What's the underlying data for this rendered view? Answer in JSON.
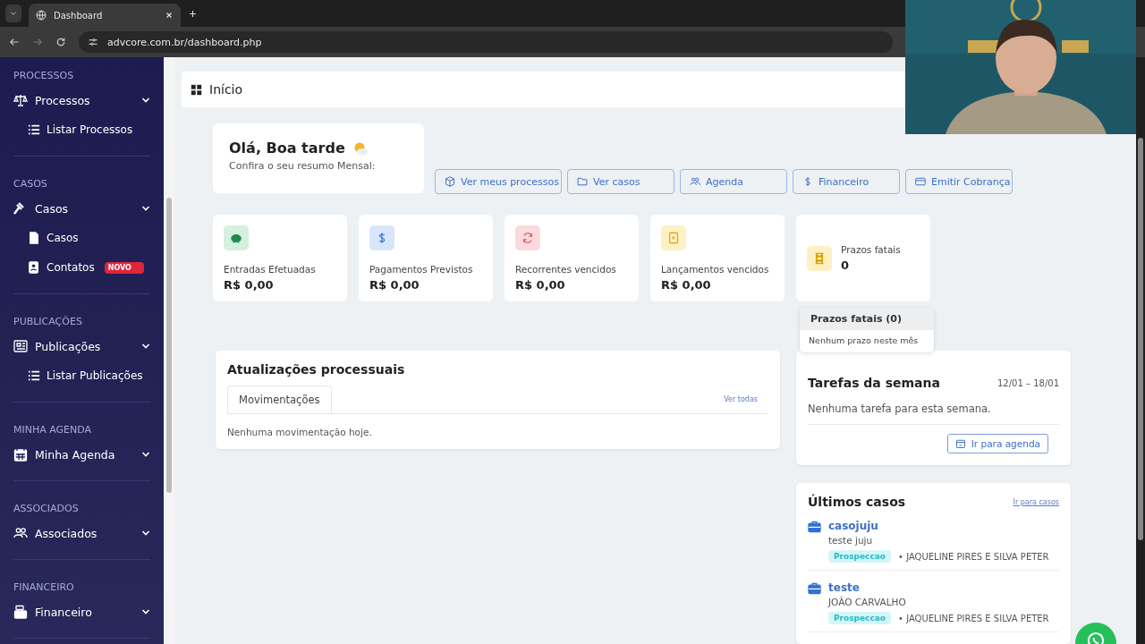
{
  "browser": {
    "tab_title": "Dashboard",
    "url": "advcore.com.br/dashboard.php"
  },
  "sidebar": {
    "sections": [
      {
        "heading": "PROCESSOS",
        "items": [
          {
            "label": "Processos",
            "children": [
              {
                "label": "Listar Processos"
              }
            ]
          }
        ]
      },
      {
        "heading": "CASOS",
        "items": [
          {
            "label": "Casos",
            "children": [
              {
                "label": "Casos"
              },
              {
                "label": "Contatos",
                "badge": "NOVO"
              }
            ]
          }
        ]
      },
      {
        "heading": "PUBLICAÇÕES",
        "items": [
          {
            "label": "Publicações",
            "children": [
              {
                "label": "Listar Publicações"
              }
            ]
          }
        ]
      },
      {
        "heading": "MINHA AGENDA",
        "items": [
          {
            "label": "Minha Agenda"
          }
        ]
      },
      {
        "heading": "ASSOCIADOS",
        "items": [
          {
            "label": "Associados"
          }
        ]
      },
      {
        "heading": "FINANCEIRO",
        "items": [
          {
            "label": "Financeiro"
          }
        ]
      }
    ]
  },
  "header": {
    "title": "Início"
  },
  "greeting": {
    "title": "Olá, Boa tarde",
    "subtitle": "Confira o seu resumo Mensal:"
  },
  "quick_actions": [
    {
      "label": "Ver meus processos"
    },
    {
      "label": "Ver casos"
    },
    {
      "label": "Agenda"
    },
    {
      "label": "Financeiro"
    },
    {
      "label": "Emitir Cobrança"
    }
  ],
  "stats": [
    {
      "kind": "money",
      "label": "Entradas Efetuadas",
      "value": "R$ 0,00",
      "color": "#d6f0e0"
    },
    {
      "kind": "money",
      "label": "Pagamentos Previstos",
      "value": "R$ 0,00",
      "color": "#d8e6fb"
    },
    {
      "kind": "money",
      "label": "Recorrentes vencidos",
      "value": "R$ 0,00",
      "color": "#fadadd"
    },
    {
      "kind": "money",
      "label": "Lançamentos vencidos",
      "value": "R$ 0,00",
      "color": "#fdf1c4"
    },
    {
      "kind": "deadline",
      "label": "Prazos fatais",
      "value": "0",
      "color": "#fdf1c4"
    }
  ],
  "popover": {
    "title": "Prazos fatais (0)",
    "text": "Nenhum prazo neste mês"
  },
  "updates": {
    "title": "Atualizações processuais",
    "tabs": [
      {
        "label": "Movimentações",
        "selected": true
      }
    ],
    "link": "Ver todas",
    "empty": "Nenhuma movimentação hoje."
  },
  "tasks": {
    "title": "Tarefas da semana",
    "range": "12/01 – 18/01",
    "empty": "Nenhuma tarefa para esta semana.",
    "button": "Ir para agenda"
  },
  "cases": {
    "title": "Últimos casos",
    "link": "Ir para casos",
    "items": [
      {
        "name": "casojuju",
        "client": "teste juju",
        "status": "Prospeccao",
        "responsible": "• JAQUELINE PIRES E SILVA PETER"
      },
      {
        "name": "teste",
        "client": "JOÃO CARVALHO",
        "status": "Prospeccao",
        "responsible": "• JAQUELINE PIRES E SILVA PETER"
      }
    ]
  }
}
